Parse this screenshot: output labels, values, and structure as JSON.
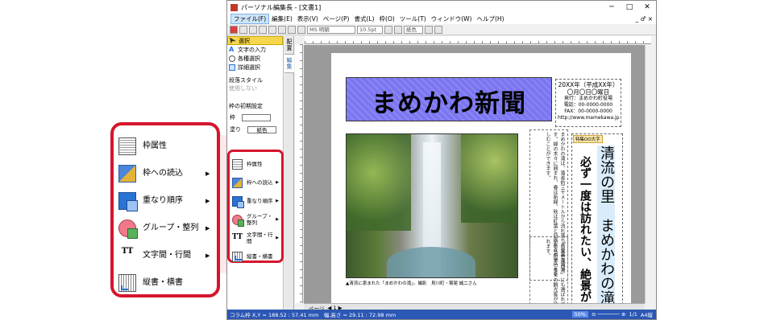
{
  "window": {
    "title": "パーソナル編集長 - [文書1]",
    "controls": [
      "─",
      "□",
      "✕"
    ]
  },
  "menu": [
    "ファイル(F)",
    "編集(E)",
    "表示(V)",
    "ページ(P)",
    "書式(L)",
    "枠(O)",
    "ツール(T)",
    "ウィンドウ(W)",
    "ヘルプ(H)"
  ],
  "menu_right": "_ ♂ ×",
  "toolbar": {
    "font": "MS 明朝",
    "size": "10.5pt",
    "color_label": "紙色"
  },
  "panel": {
    "tools": [
      {
        "label": "選択",
        "selected": true
      },
      {
        "label": "文字の入力"
      },
      {
        "label": "各種選択"
      },
      {
        "label": "詳細選択"
      }
    ],
    "style_label": "段落スタイル",
    "style_value": "使用しない",
    "frame_settings": "枠の初期設定",
    "line_label": "枠",
    "fill_label": "塗り",
    "fill_value": "紙色"
  },
  "vtabs": [
    "配置",
    "編集"
  ],
  "context_menu": [
    {
      "label": "枠属性",
      "icon": "frame-properties-icon",
      "arrow": ""
    },
    {
      "label": "枠への読込",
      "icon": "frame-load-icon",
      "arrow": "▶"
    },
    {
      "label": "重なり順序",
      "icon": "stack-order-icon",
      "arrow": "▶"
    },
    {
      "label": "グループ・整列",
      "icon": "group-align-icon",
      "arrow": "▶"
    },
    {
      "label": "文字間・行間",
      "icon": "char-line-spacing-icon",
      "arrow": "▶"
    },
    {
      "label": "縦書・横書",
      "icon": "vertical-horizontal-icon",
      "arrow": ""
    }
  ],
  "newspaper": {
    "masthead": "まめかわ新聞",
    "date_line": "20XX年（平成XX年）",
    "day_line": "〇月〇日〇曜日",
    "publisher": "発行：まめかわ町役場",
    "tel": "電話：00-0000-0000",
    "fax": "FAX：00-0000-0000",
    "url": "http://www.mamekawa.jp",
    "tag": "特集OO大字",
    "headline1": "清流の里　まめかわの滝",
    "headline2": "必ず一度は訪れたい、絶景が",
    "body1": "まめかわの滝は、落差約三十メートルから流れ落ちる見事な滝です。緑の木々に囲まれ、春は新緑、秋は紅葉と四季折々の景色を楽しむことができます。",
    "body2": "「日本の滝百選」にも選ばれている名所で、多くの観光客が訪れます。",
    "caption": "▲清流に恵まれた「まめかわの滝」。撮影　見川町・鷲尾 誠二さん"
  },
  "status": {
    "left": "コラム枠 X,Y = 188.52 : 57.41 mm　幅,高さ = 29.11 : 72.98 mm",
    "zoom": "50%",
    "page_indicator": "1/1",
    "paper": "A4縦",
    "page_nav": "ページ"
  }
}
